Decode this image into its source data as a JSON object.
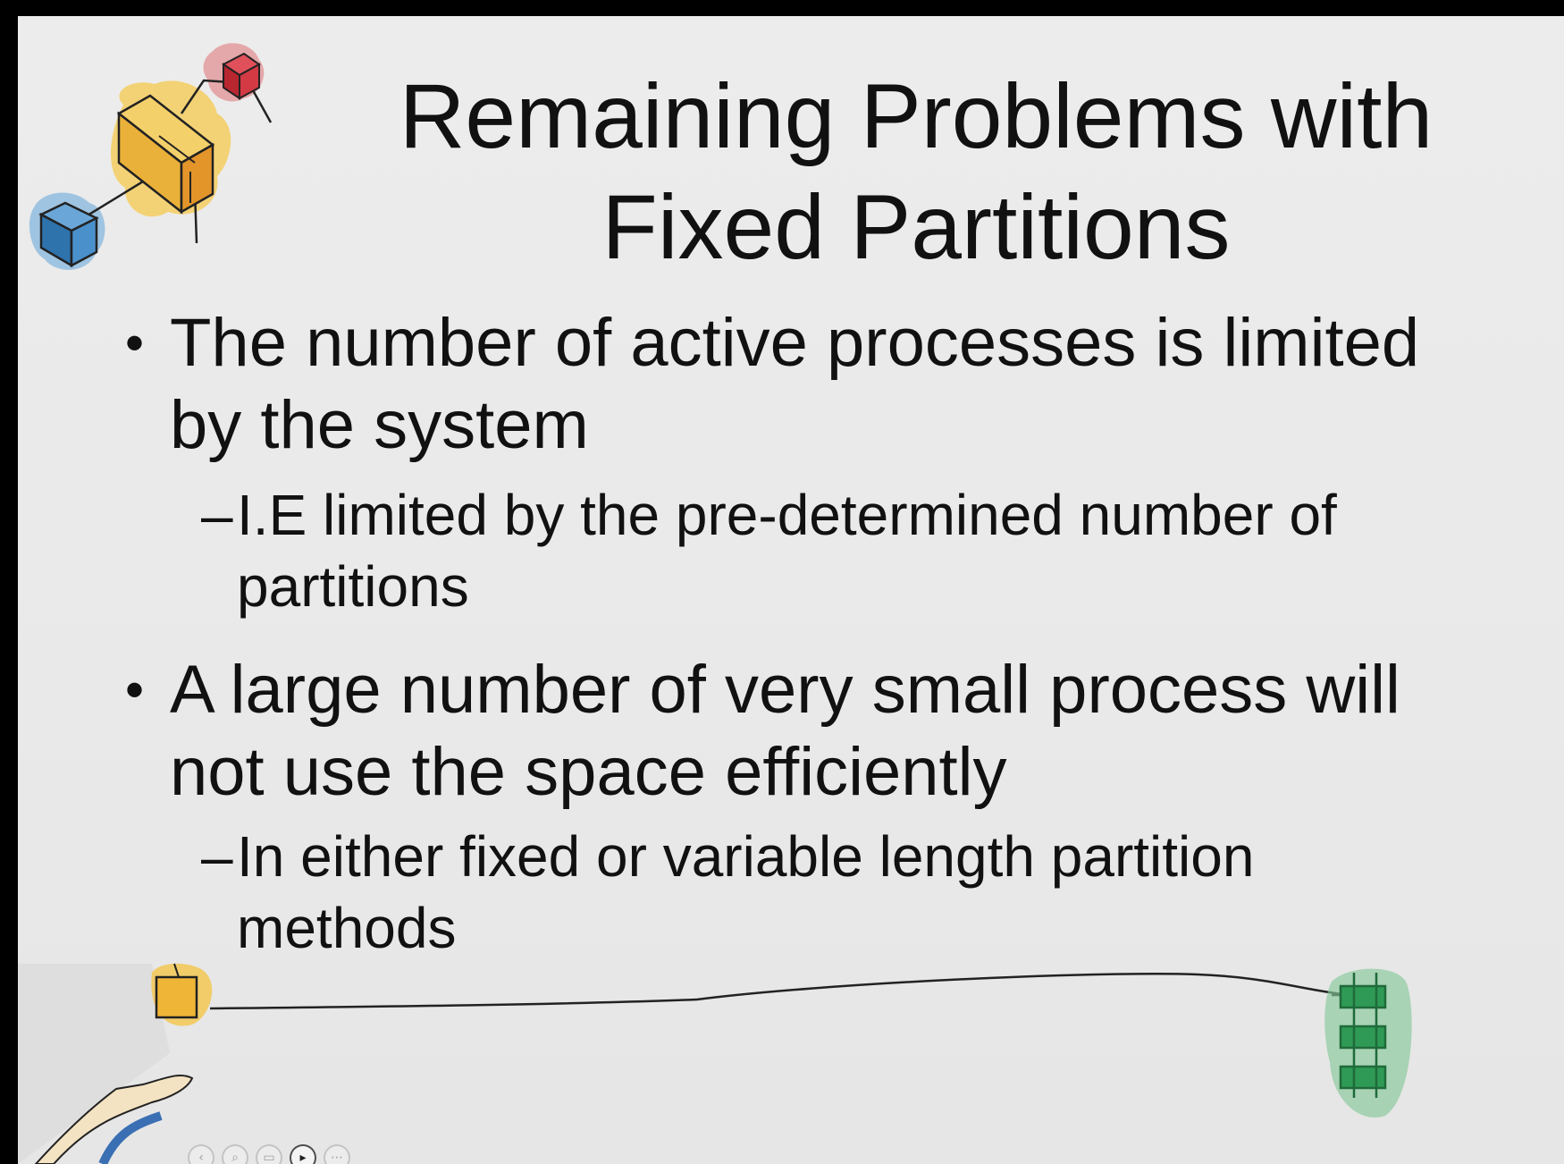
{
  "slide": {
    "title_lines": [
      "Remaining Problems with",
      "Fixed Partitions"
    ],
    "bullets": [
      {
        "text": "The number of active processes is limited by the system",
        "sub": "I.E limited by the pre-determined number of partitions"
      },
      {
        "text": "A large number of very small process will not use the space efficiently",
        "sub": "In either fixed or variable length partition methods"
      }
    ],
    "bullet_glyph": "•",
    "sub_glyph": "–"
  },
  "toolbar": {
    "icons": [
      "back-icon",
      "zoom-icon",
      "slides-icon",
      "video-icon",
      "more-icon"
    ]
  },
  "colors": {
    "background": "#e9e9e9",
    "text": "#111111",
    "cube_red": "#c7303a",
    "cube_yellow": "#f0b52e",
    "cube_blue": "#3b86c4",
    "ladder_green": "#2f9a55"
  }
}
